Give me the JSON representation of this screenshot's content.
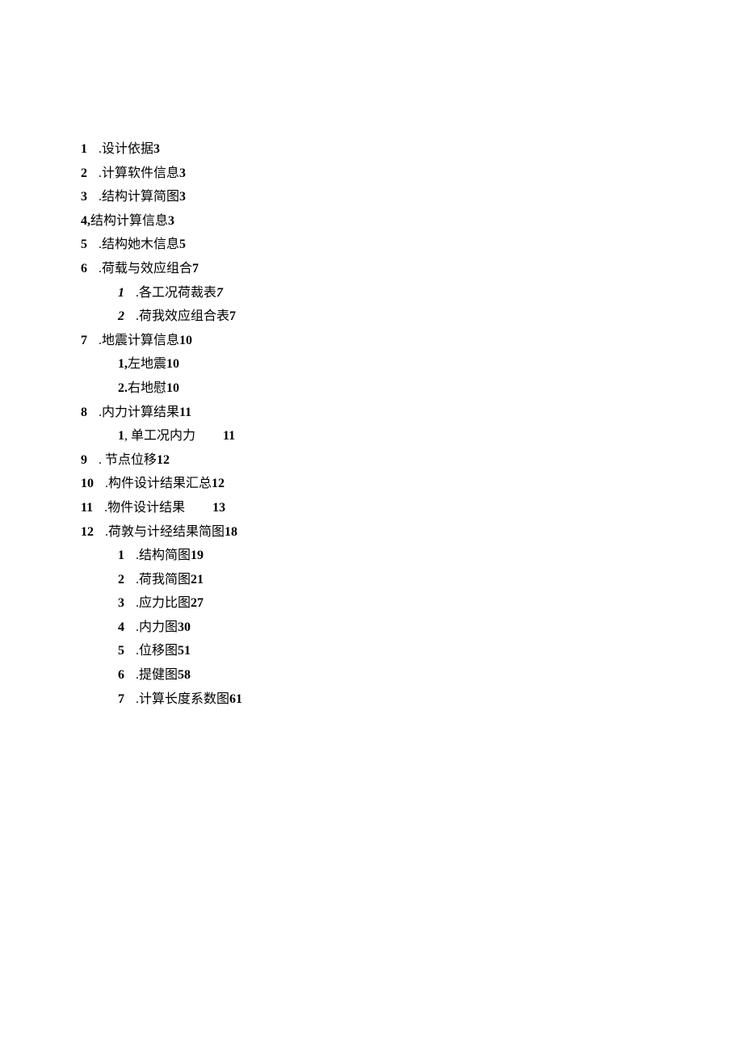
{
  "toc": [
    {
      "level": 0,
      "num": "1",
      "numStyle": "bold",
      "sepClass": "gap-small",
      "sep": ".",
      "label": "设计依据",
      "page": "3"
    },
    {
      "level": 0,
      "num": "2",
      "numStyle": "bold",
      "sepClass": "gap-small",
      "sep": ".",
      "label": "计算软件信息",
      "page": "3"
    },
    {
      "level": 0,
      "num": "3",
      "numStyle": "bold",
      "sepClass": "gap-small",
      "sep": ".",
      "label": "结构计算简图",
      "page": "3"
    },
    {
      "level": 0,
      "num": "4,",
      "numStyle": "bold",
      "sepClass": "",
      "sep": "",
      "label": "结构计算信息",
      "page": "3"
    },
    {
      "level": 0,
      "num": "5",
      "numStyle": "bold",
      "sepClass": "gap-small",
      "sep": ".",
      "label": "结构她木信息",
      "page": "5"
    },
    {
      "level": 0,
      "num": "6",
      "numStyle": "bold",
      "sepClass": "gap-small",
      "sep": ".",
      "label": "荷载与效应组合",
      "page": "7"
    },
    {
      "level": 1,
      "num": "1",
      "numStyle": "italic",
      "sepClass": "gap-small",
      "sep": ".",
      "label": "各工况荷裁表",
      "page": "7",
      "pageItalic": true
    },
    {
      "level": 1,
      "num": "2",
      "numStyle": "italic",
      "sepClass": "gap-small",
      "sep": ".",
      "label": "荷我效应组合表",
      "page": "7"
    },
    {
      "level": 0,
      "num": "7",
      "numStyle": "bold",
      "sepClass": "gap-small",
      "sep": ".",
      "label": "地震计算信息",
      "page": "10"
    },
    {
      "level": 1,
      "num": "1,",
      "numStyle": "bold",
      "sepClass": "",
      "sep": "",
      "label": "左地震",
      "page": "10"
    },
    {
      "level": 1,
      "num": "2.",
      "numStyle": "bold",
      "sepClass": "",
      "sep": "",
      "label": "右地慰",
      "page": "10"
    },
    {
      "level": 0,
      "num": "8",
      "numStyle": "bold",
      "sepClass": "gap-small",
      "sep": ".",
      "label": "内力计算结果",
      "page": "11"
    },
    {
      "level": 1,
      "num": "1",
      "numStyle": "bold",
      "sepClass": "",
      "sep": ", ",
      "label": "单工况内力",
      "page": "11",
      "pagePad": true
    },
    {
      "level": 0,
      "num": "9",
      "numStyle": "bold",
      "sepClass": "gap-small",
      "sep": ". ",
      "label": "节点位移",
      "page": "12"
    },
    {
      "level": 0,
      "num": "10",
      "numStyle": "bold",
      "sepClass": "gap-small",
      "sep": ".",
      "label": "构件设计结果汇总",
      "page": "12"
    },
    {
      "level": 0,
      "num": "11",
      "numStyle": "bold",
      "sepClass": "gap-small",
      "sep": ".",
      "label": "物件设计结果",
      "page": "13",
      "pagePad": true
    },
    {
      "level": 0,
      "num": "12",
      "numStyle": "bold",
      "sepClass": "gap-small",
      "sep": ".",
      "label": "荷敦与计经结果简图",
      "page": "18"
    },
    {
      "level": 1,
      "num": "1",
      "numStyle": "bold",
      "sepClass": "gap-small",
      "sep": ".",
      "label": "结构简图",
      "page": "19"
    },
    {
      "level": 1,
      "num": "2",
      "numStyle": "bold",
      "sepClass": "gap-small",
      "sep": ".",
      "label": "荷我简图",
      "page": "21"
    },
    {
      "level": 1,
      "num": "3",
      "numStyle": "bold",
      "sepClass": "gap-small",
      "sep": ".",
      "label": "应力比图",
      "page": "27"
    },
    {
      "level": 1,
      "num": "4",
      "numStyle": "bold",
      "sepClass": "gap-small",
      "sep": ".",
      "label": "内力图",
      "page": "30"
    },
    {
      "level": 1,
      "num": "5",
      "numStyle": "bold",
      "sepClass": "gap-small",
      "sep": ".",
      "label": "位移图",
      "page": "51"
    },
    {
      "level": 1,
      "num": "6",
      "numStyle": "bold",
      "sepClass": "gap-small",
      "sep": ".",
      "label": "提健图",
      "page": "58"
    },
    {
      "level": 1,
      "num": "7",
      "numStyle": "bold",
      "sepClass": "gap-small",
      "sep": ".",
      "label": "计算长度系数图",
      "page": "61"
    }
  ]
}
